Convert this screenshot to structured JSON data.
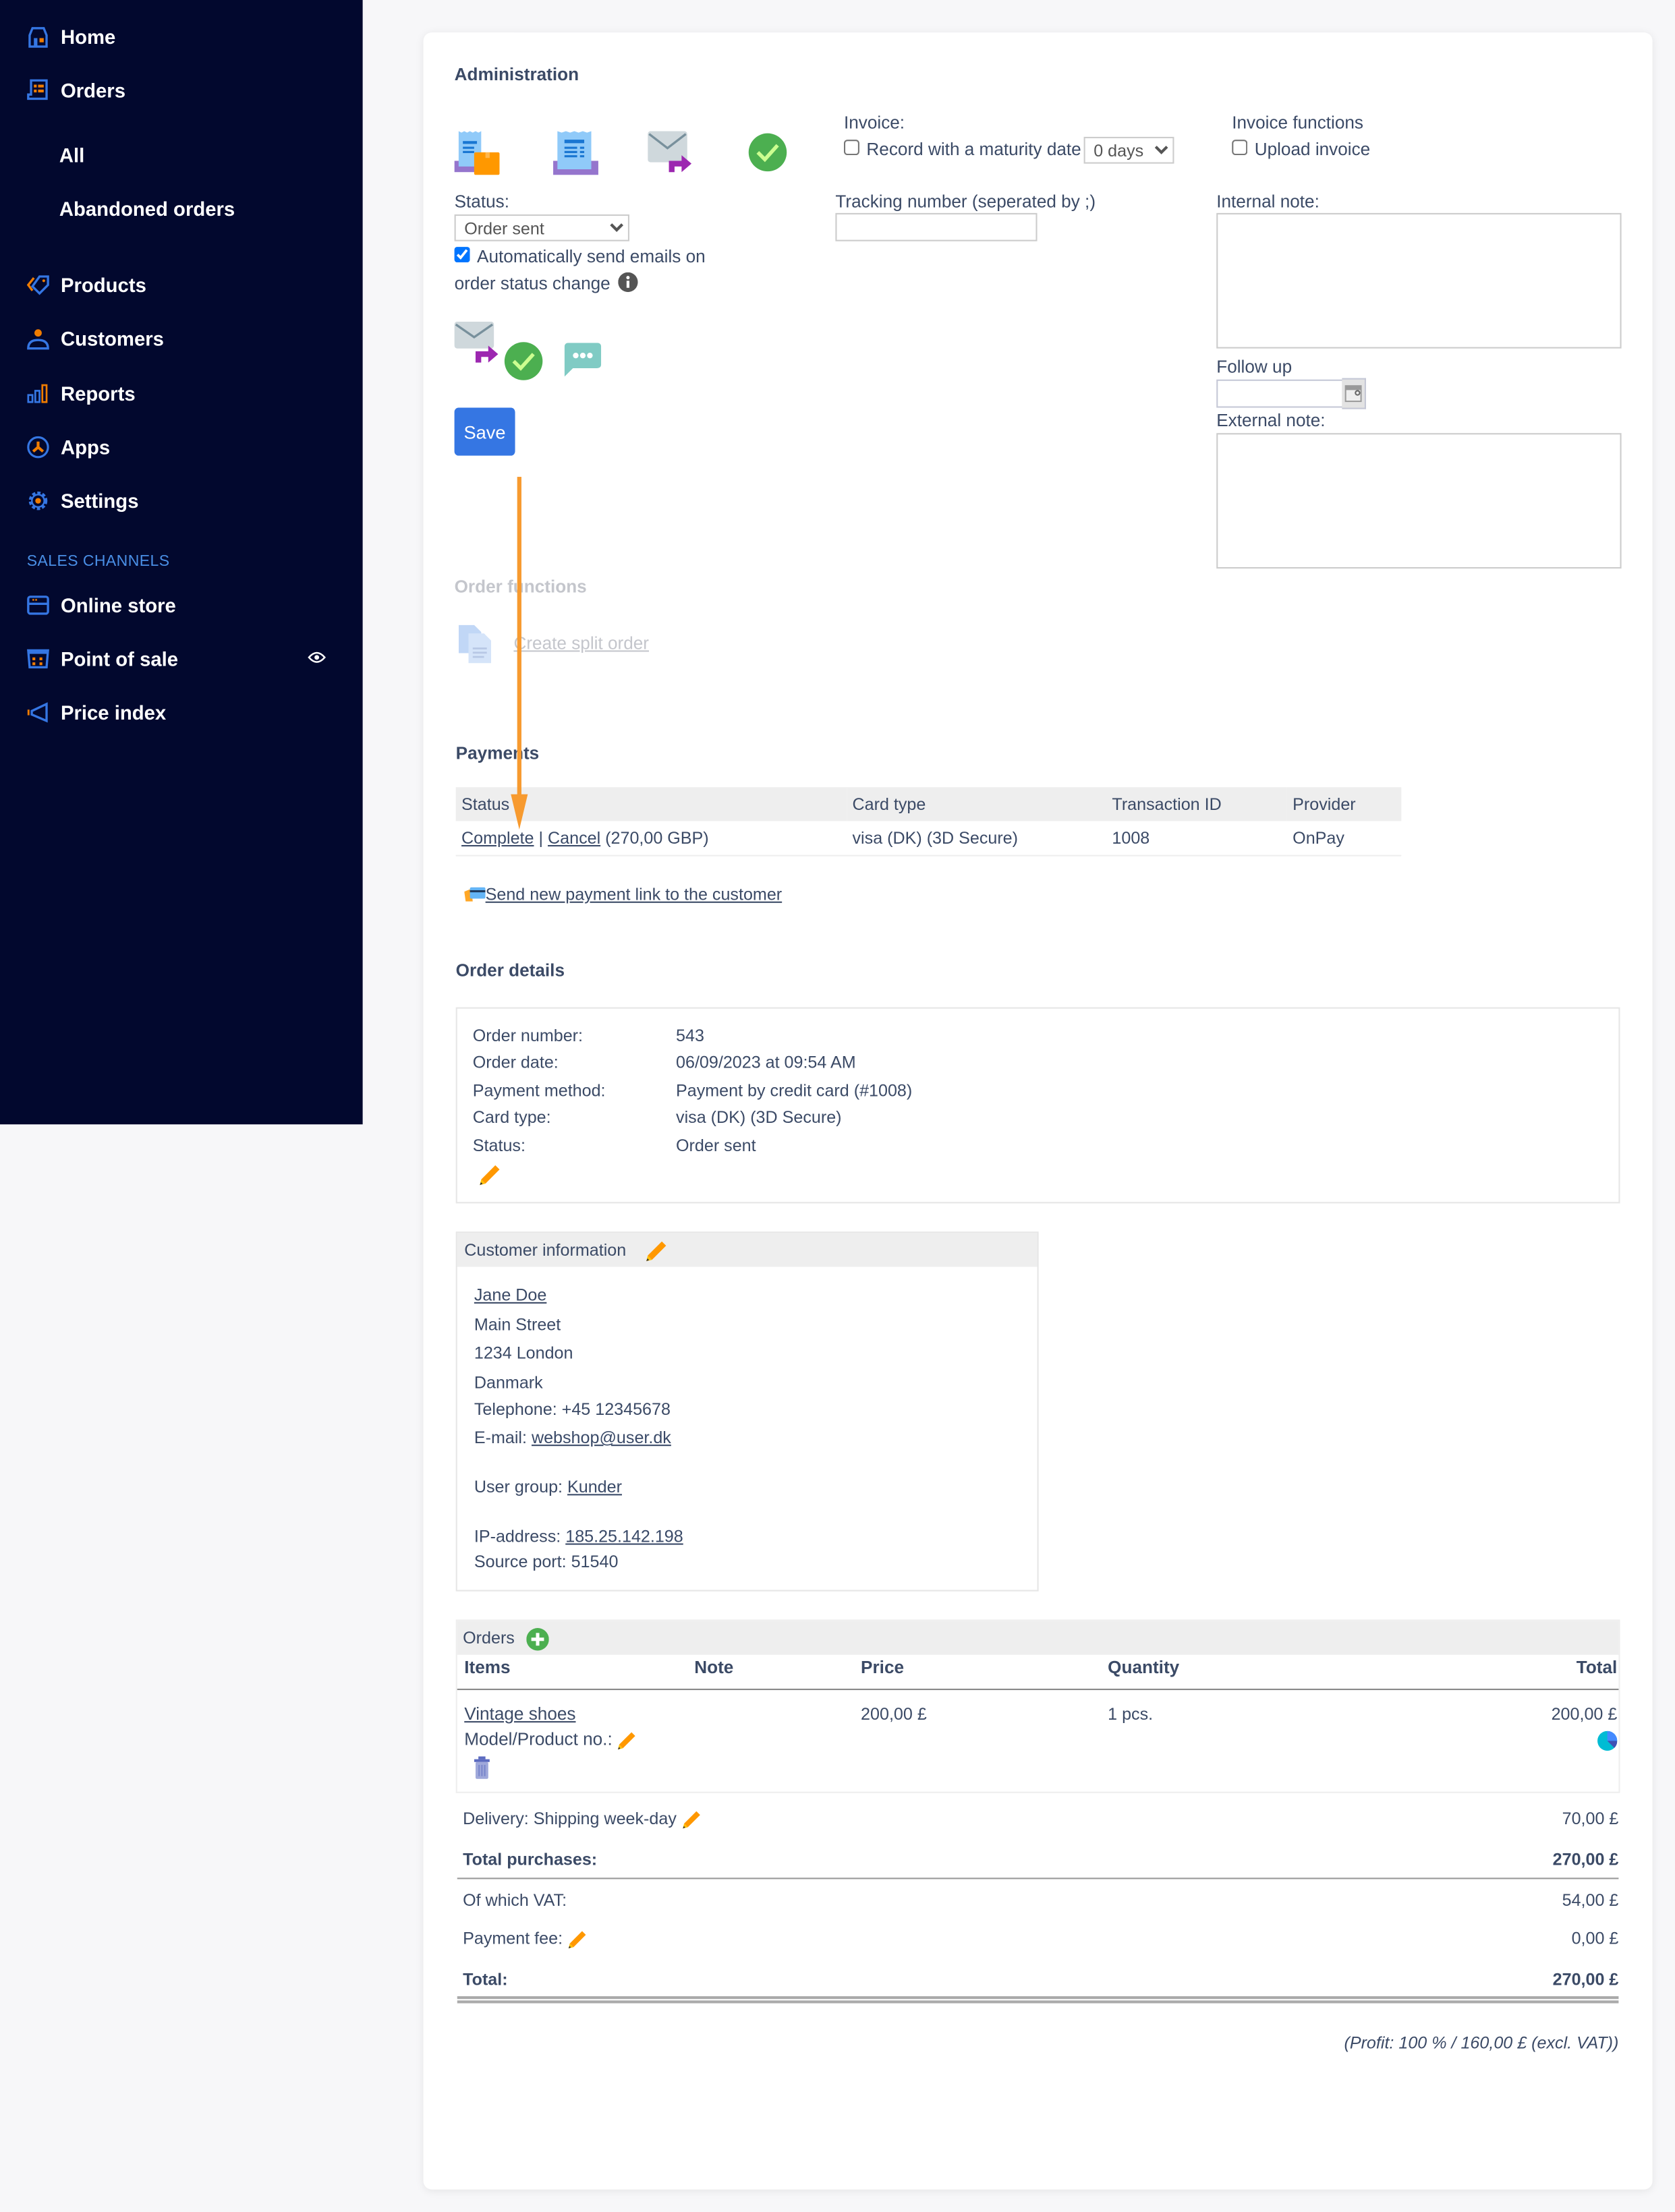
{
  "sidebar": {
    "items": [
      {
        "label": "Home",
        "icon": "home-icon"
      },
      {
        "label": "Orders",
        "icon": "orders-icon"
      },
      {
        "label": "Products",
        "icon": "tag-icon"
      },
      {
        "label": "Customers",
        "icon": "person-icon"
      },
      {
        "label": "Reports",
        "icon": "bar-chart-icon"
      },
      {
        "label": "Apps",
        "icon": "apps-icon"
      },
      {
        "label": "Settings",
        "icon": "gear-icon"
      }
    ],
    "orders_sub": [
      "All",
      "Abandoned orders"
    ],
    "sales_channels_header": "SALES CHANNELS",
    "channels": [
      {
        "label": "Online store",
        "icon": "store-icon"
      },
      {
        "label": "Point of sale",
        "icon": "pos-icon"
      },
      {
        "label": "Price index",
        "icon": "megaphone-icon"
      }
    ],
    "colors": {
      "background": "#02082e",
      "accent": "#3576e3",
      "secondary": "#f07c00"
    }
  },
  "administration": {
    "title": "Administration",
    "status_label": "Status:",
    "status_value": "Order sent",
    "auto_email_checked": true,
    "auto_email_label_1": "Automatically send emails on",
    "auto_email_label_2": "order status change",
    "save_label": "Save",
    "invoice_label": "Invoice:",
    "maturity_checked": false,
    "maturity_label": "Record with a maturity date",
    "maturity_days": "0 days",
    "invoice_functions_label": "Invoice functions",
    "upload_checked": false,
    "upload_label": "Upload invoice",
    "tracking_label": "Tracking number (seperated by ;)",
    "tracking_value": "",
    "internal_note_label": "Internal note:",
    "internal_note_value": "",
    "follow_up_label": "Follow up",
    "follow_up_value": "",
    "external_note_label": "External note:",
    "external_note_value": ""
  },
  "order_functions": {
    "title": "Order functions",
    "split_order_label": "Create split order"
  },
  "payments": {
    "title": "Payments",
    "columns": [
      "Status",
      "Card type",
      "Transaction ID",
      "Provider"
    ],
    "rows": [
      {
        "complete": "Complete",
        "sep": "|",
        "cancel": "Cancel",
        "amount": "(270,00 GBP)",
        "card_type": "visa (DK) (3D Secure)",
        "transaction_id": "1008",
        "provider": "OnPay"
      }
    ],
    "send_link_label": "Send new payment link to the customer"
  },
  "order_details": {
    "title": "Order details",
    "rows": [
      {
        "label": "Order number:",
        "value": "543"
      },
      {
        "label": "Order date:",
        "value": "06/09/2023 at 09:54 AM"
      },
      {
        "label": "Payment method:",
        "value": "Payment by credit card (#1008)"
      },
      {
        "label": "Card type:",
        "value": "visa (DK) (3D Secure)"
      },
      {
        "label": "Status:",
        "value": "Order sent"
      }
    ]
  },
  "customer": {
    "header": "Customer information",
    "name": "Jane Doe",
    "street": "Main Street",
    "city": "1234 London",
    "country": "Danmark",
    "telephone": "Telephone: +45 12345678",
    "email_label": "E-mail: ",
    "email": "webshop@user.dk",
    "user_group_label": "User group: ",
    "user_group": "Kunder",
    "ip_label": "IP-address: ",
    "ip": "185.25.142.198",
    "source_port": "Source port: 51540"
  },
  "orders": {
    "header": "Orders",
    "columns": [
      "Items",
      "Note",
      "Price",
      "Quantity",
      "Total"
    ],
    "items": [
      {
        "name": "Vintage shoes",
        "model_label": "Model/Product no.:",
        "note": "",
        "price": "200,00 £",
        "quantity": "1 pcs.",
        "total": "200,00 £"
      }
    ],
    "delivery_label": "Delivery: Shipping week-day",
    "delivery_value": "70,00 £",
    "total_purchases_label": "Total purchases:",
    "total_purchases_value": "270,00 £",
    "vat_label": "Of which VAT:",
    "vat_value": "54,00 £",
    "payment_fee_label": "Payment fee:",
    "payment_fee_value": "0,00 £",
    "total_label": "Total:",
    "total_value": "270,00 £",
    "profit": "(Profit: 100 % / 160,00 £ (excl. VAT))"
  }
}
